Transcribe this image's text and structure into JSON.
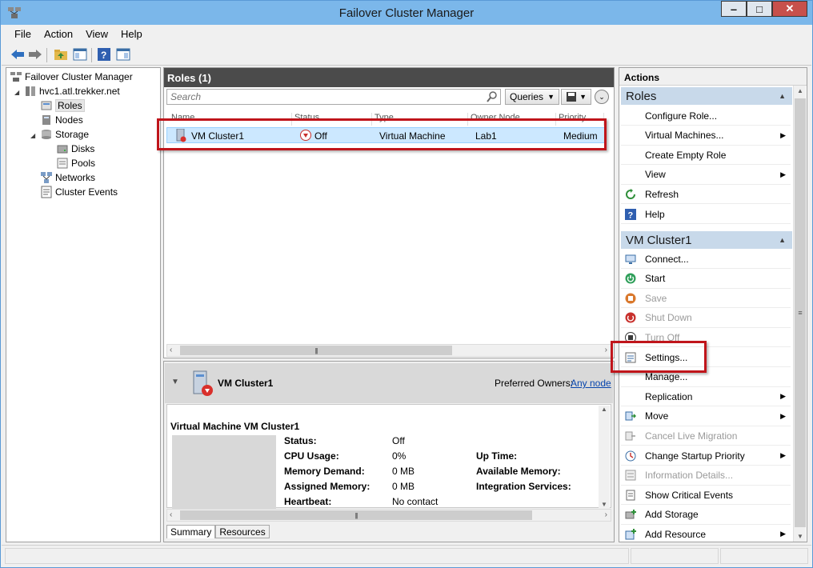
{
  "window": {
    "title": "Failover Cluster Manager"
  },
  "menu": [
    "File",
    "Action",
    "View",
    "Help"
  ],
  "tree": {
    "root": "Failover Cluster Manager",
    "cluster": "hvc1.atl.trekker.net",
    "roles": "Roles",
    "nodes": "Nodes",
    "storage": "Storage",
    "disks": "Disks",
    "pools": "Pools",
    "networks": "Networks",
    "cluster_events": "Cluster Events"
  },
  "roles_panel": {
    "title": "Roles (1)",
    "search_placeholder": "Search",
    "queries_label": "Queries",
    "columns": [
      "Name",
      "Status",
      "Type",
      "Owner Node",
      "Priority"
    ],
    "rows": [
      {
        "name": "VM Cluster1",
        "status": "Off",
        "type": "Virtual Machine",
        "owner": "Lab1",
        "priority": "Medium"
      }
    ]
  },
  "details": {
    "title": "VM Cluster1",
    "preferred_owners_label": "Preferred Owners:",
    "preferred_owners_link": "Any node",
    "section_title": "Virtual Machine VM Cluster1",
    "status_label": "Status:",
    "status_value": "Off",
    "cpu_label": "CPU Usage:",
    "cpu_value": "0%",
    "memdemand_label": "Memory Demand:",
    "memdemand_value": "0 MB",
    "assigned_label": "Assigned Memory:",
    "assigned_value": "0 MB",
    "heartbeat_label": "Heartbeat:",
    "heartbeat_value": "No contact",
    "uptime_label": "Up Time:",
    "availmem_label": "Available Memory:",
    "integration_label": "Integration Services:",
    "tabs": [
      "Summary",
      "Resources"
    ]
  },
  "actions": {
    "header": "Actions",
    "group_roles": "Roles",
    "roles_items": [
      {
        "label": "Configure Role...",
        "icon": "blank"
      },
      {
        "label": "Virtual Machines...",
        "icon": "blank",
        "submenu": true
      },
      {
        "label": "Create Empty Role",
        "icon": "blank"
      },
      {
        "label": "View",
        "icon": "blank",
        "submenu": true
      },
      {
        "label": "Refresh",
        "icon": "refresh-icon"
      },
      {
        "label": "Help",
        "icon": "help-icon"
      }
    ],
    "group_vm": "VM Cluster1",
    "vm_items": [
      {
        "label": "Connect...",
        "icon": "connect-icon"
      },
      {
        "label": "Start",
        "icon": "start-icon"
      },
      {
        "label": "Save",
        "icon": "save-icon",
        "disabled": true
      },
      {
        "label": "Shut Down",
        "icon": "shutdown-icon",
        "disabled": true
      },
      {
        "label": "Turn Off",
        "icon": "turnoff-icon",
        "disabled": true
      },
      {
        "label": "Settings...",
        "icon": "settings-icon"
      },
      {
        "label": "Manage...",
        "icon": "blank"
      },
      {
        "label": "Replication",
        "icon": "blank",
        "submenu": true
      },
      {
        "label": "Move",
        "icon": "move-icon",
        "submenu": true
      },
      {
        "label": "Cancel Live Migration",
        "icon": "cancel-migration-icon",
        "disabled": true
      },
      {
        "label": "Change Startup Priority",
        "icon": "priority-icon",
        "submenu": true
      },
      {
        "label": "Information Details...",
        "icon": "info-icon",
        "disabled": true
      },
      {
        "label": "Show Critical Events",
        "icon": "events-icon"
      },
      {
        "label": "Add Storage",
        "icon": "add-storage-icon"
      },
      {
        "label": "Add Resource",
        "icon": "add-resource-icon",
        "submenu": true
      }
    ]
  }
}
